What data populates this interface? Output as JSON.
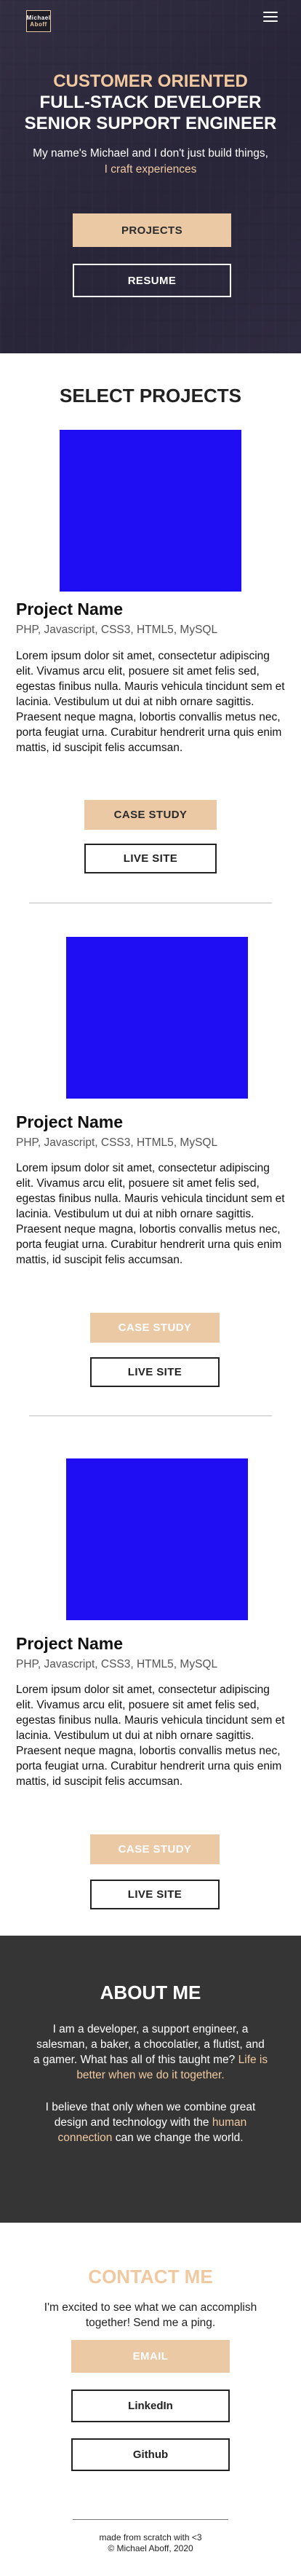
{
  "header": {
    "logo_line1": "Michael",
    "logo_line2": "Abo",
    "logo_line3": "ff"
  },
  "hero": {
    "eyebrow": "CUSTOMER ORIENTED",
    "title_line1": "FULL-STACK DEVELOPER",
    "title_line2": "SENIOR SUPPORT ENGINEER",
    "intro_line1": "My name's Michael and I don't just build things,",
    "intro_line2": "I craft experiences",
    "projects_button": "PROJECTS",
    "resume_button": "RESUME"
  },
  "projects": {
    "heading": "SELECT PROJECTS",
    "items": [
      {
        "name": "Project Name",
        "tech": "PHP, Javascript, CSS3, HTML5, MySQL",
        "description": "Lorem ipsum dolor sit amet, consectetur adipiscing elit. Vivamus arcu elit, posuere sit amet felis sed, egestas finibus nulla. Mauris vehicula tincidunt sem et lacinia. Vestibulum ut dui at nibh ornare sagittis. Praesent neque magna, lobortis convallis metus nec, porta feugiat urna. Curabitur hendrerit urna quis enim mattis, id suscipit felis accumsan.",
        "case_study": "CASE STUDY",
        "live_site": "LIVE SITE"
      },
      {
        "name": "Project Name",
        "tech": "PHP, Javascript, CSS3, HTML5, MySQL",
        "description": "Lorem ipsum dolor sit amet, consectetur adipiscing elit. Vivamus arcu elit, posuere sit amet felis sed, egestas finibus nulla. Mauris vehicula tincidunt sem et lacinia. Vestibulum ut dui at nibh ornare sagittis. Praesent neque magna, lobortis convallis metus nec, porta feugiat urna. Curabitur hendrerit urna quis enim mattis, id suscipit felis accumsan.",
        "case_study": "CASE STUDY",
        "live_site": "LIVE SITE"
      },
      {
        "name": "Project Name",
        "tech": "PHP, Javascript, CSS3, HTML5, MySQL",
        "description": "Lorem ipsum dolor sit amet, consectetur adipiscing elit. Vivamus arcu elit, posuere sit amet felis sed, egestas finibus nulla. Mauris vehicula tincidunt sem et lacinia. Vestibulum ut dui at nibh ornare sagittis. Praesent neque magna, lobortis convallis metus nec, porta feugiat urna. Curabitur hendrerit urna quis enim mattis, id suscipit felis accumsan.",
        "case_study": "CASE STUDY",
        "live_site": "LIVE SITE"
      }
    ]
  },
  "about": {
    "heading": "ABOUT ME",
    "p1_text": "I am a developer, a support engineer, a salesman, a baker, a chocolatier, a flutist, and a gamer. What has all of this taught me?",
    "p1_accent": "Life is better when we do it together.",
    "p2_text": "I believe that only when we combine great design and technology with the",
    "p2_accent": "human connection",
    "p2_end": "can we change the world."
  },
  "contact": {
    "heading": "CONTACT ME",
    "text": "I'm excited to see what we can accomplish together! Send me a ping.",
    "email_button": "EMAIL",
    "linkedin_button": "LinkedIn",
    "github_button": "Github"
  },
  "footer": {
    "line1": "made from scratch with <3",
    "line2": "© Michael Aboff, 2020"
  },
  "colors": {
    "accent": "#f1c9a0",
    "button_gold": "#ebc9a5",
    "project_image": "#1f0ef4",
    "about_bg": "#353535",
    "hero_overlay": "#3a3547"
  },
  "icons": {
    "menu": "hamburger-menu-icon"
  }
}
